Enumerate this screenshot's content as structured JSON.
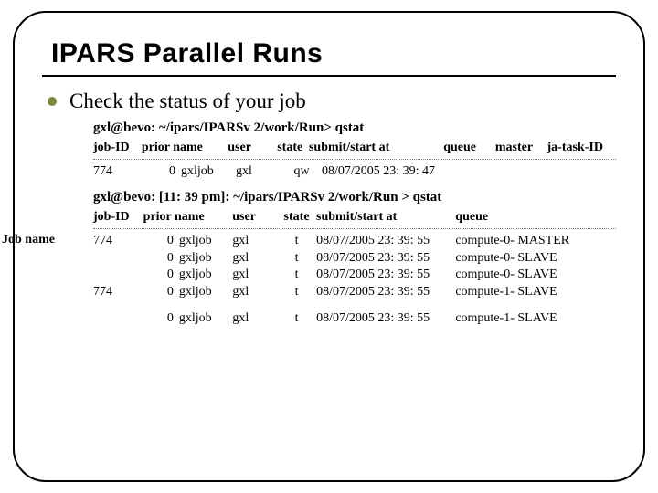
{
  "title": "IPARS Parallel Runs",
  "bullet": "Check the status of your job",
  "annot": "Job name",
  "sec1": {
    "cmd": "gxl@bevo: ~/ipars/IPARSv 2/work/Run> qstat",
    "hdr": {
      "jobid": "job-ID",
      "priorname": "prior name",
      "user": "user",
      "state": "state",
      "submit": "submit/start at",
      "queue": "queue",
      "master": "master",
      "task": "ja-task-ID"
    },
    "row": {
      "jobid": "774",
      "prior": "0",
      "name": "gxljob",
      "user": "gxl",
      "state": "qw",
      "submit": "08/07/2005 23: 39: 47"
    }
  },
  "sec2": {
    "cmd": "gxl@bevo: [11: 39 pm]: ~/ipars/IPARSv 2/work/Run > qstat",
    "hdr": {
      "jobid": "job-ID",
      "priorname": "prior name",
      "user": "user",
      "state": "state",
      "submit": "submit/start at",
      "queue": "queue"
    },
    "rows": [
      {
        "jobid": "774",
        "prior": "0",
        "name": "gxljob",
        "user": "gxl",
        "state": "t",
        "submit": "08/07/2005 23: 39: 55",
        "queue": "compute-0- MASTER"
      },
      {
        "jobid": "",
        "prior": "0",
        "name": "gxljob",
        "user": "gxl",
        "state": "t",
        "submit": "08/07/2005 23: 39: 55",
        "queue": "compute-0- SLAVE"
      },
      {
        "jobid": "",
        "prior": "0",
        "name": "gxljob",
        "user": "gxl",
        "state": "t",
        "submit": "08/07/2005 23: 39: 55",
        "queue": "compute-0- SLAVE"
      },
      {
        "jobid": "774",
        "prior": "0",
        "name": "gxljob",
        "user": "gxl",
        "state": "t",
        "submit": "08/07/2005 23: 39: 55",
        "queue": "compute-1- SLAVE"
      },
      {
        "jobid": "",
        "prior": "0",
        "name": "gxljob",
        "user": "gxl",
        "state": "t",
        "submit": "08/07/2005 23: 39: 55",
        "queue": "compute-1- SLAVE"
      }
    ]
  }
}
